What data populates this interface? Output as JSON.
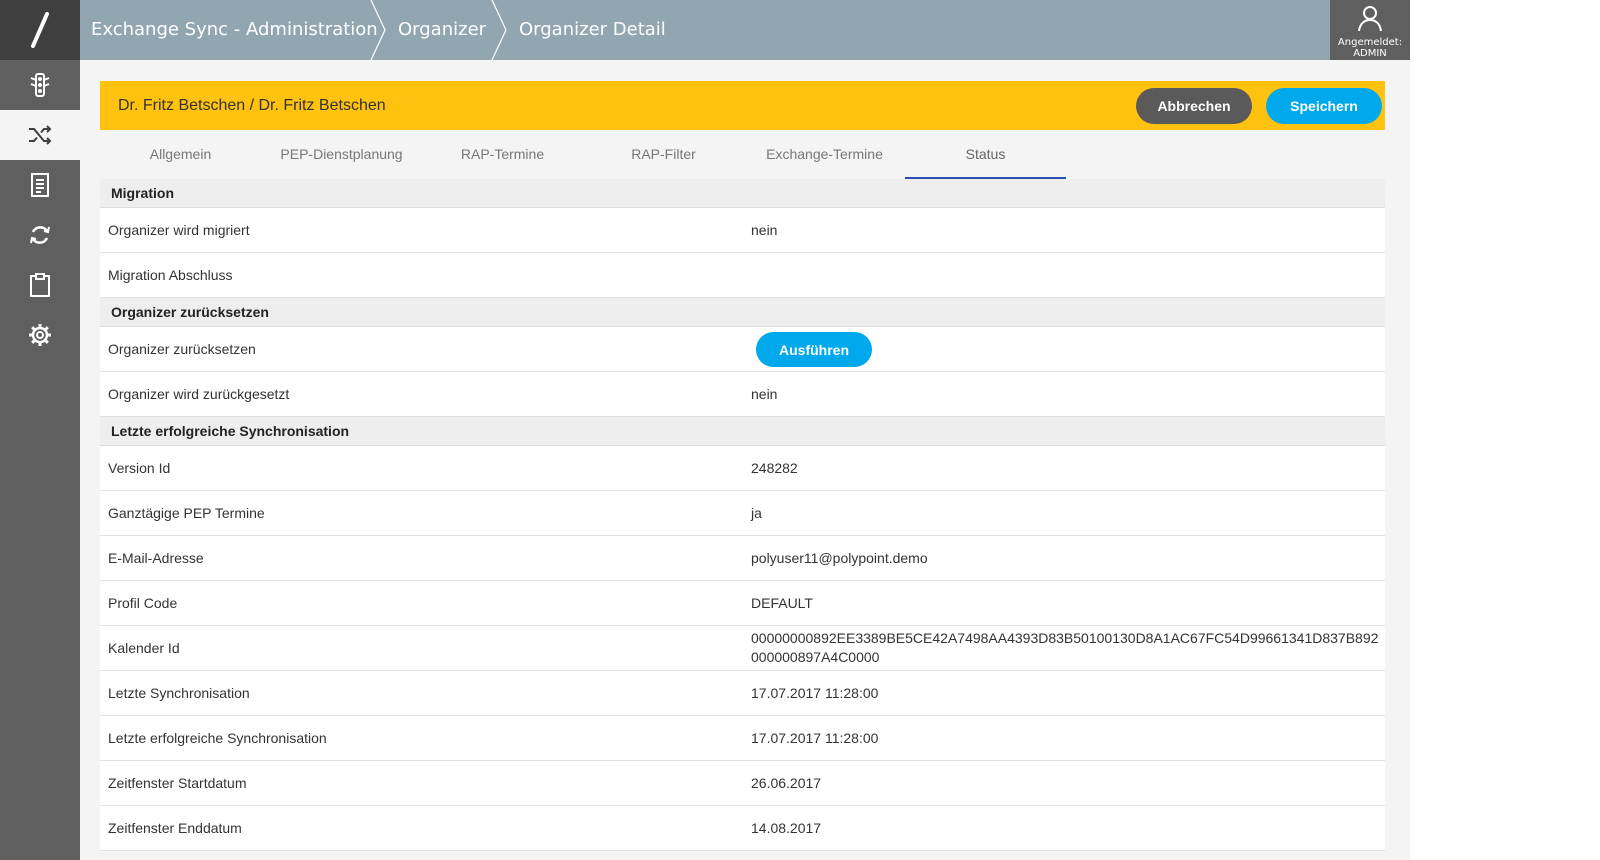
{
  "sidebar": {
    "logo_icon": "slash-logo",
    "items": [
      {
        "icon": "traffic-light-icon",
        "active": false
      },
      {
        "icon": "shuffle-icon",
        "active": true
      },
      {
        "icon": "document-list-icon",
        "active": false
      },
      {
        "icon": "sync-icon",
        "active": false
      },
      {
        "icon": "clipboard-icon",
        "active": false
      },
      {
        "icon": "gear-icon",
        "active": false
      }
    ]
  },
  "header": {
    "breadcrumbs": [
      "Exchange Sync - Administration",
      "Organizer",
      "Organizer Detail"
    ],
    "user_line1": "Angemeldet:",
    "user_line2": "ADMIN"
  },
  "record": {
    "title": "Dr. Fritz Betschen / Dr. Fritz Betschen",
    "cancel_label": "Abbrechen",
    "save_label": "Speichern"
  },
  "tabs": [
    {
      "label": "Allgemein"
    },
    {
      "label": "PEP-Dienstplanung"
    },
    {
      "label": "RAP-Termine"
    },
    {
      "label": "RAP-Filter"
    },
    {
      "label": "Exchange-Termine"
    },
    {
      "label": "Status",
      "active": true
    }
  ],
  "sections": {
    "migration": {
      "title": "Migration",
      "rows": [
        {
          "label": "Organizer wird migriert",
          "value": "nein"
        },
        {
          "label": "Migration Abschluss",
          "value": ""
        }
      ]
    },
    "reset": {
      "title": "Organizer zurücksetzen",
      "action_label": "Organizer zurücksetzen",
      "action_button": "Ausführen",
      "rows": [
        {
          "label": "Organizer wird zurückgesetzt",
          "value": "nein"
        }
      ]
    },
    "sync": {
      "title": "Letzte erfolgreiche Synchronisation",
      "rows": [
        {
          "label": "Version Id",
          "value": "248282"
        },
        {
          "label": "Ganztägige PEP Termine",
          "value": "ja"
        },
        {
          "label": "E-Mail-Adresse",
          "value": "polyuser11@polypoint.demo"
        },
        {
          "label": "Profil Code",
          "value": "DEFAULT"
        },
        {
          "label": "Kalender Id",
          "value": "00000000892EE3389BE5CE42A7498AA4393D83B50100130D8A1AC67FC54D99661341D837B892000000897A4C0000"
        },
        {
          "label": "Letzte Synchronisation",
          "value": "17.07.2017 11:28:00"
        },
        {
          "label": "Letzte erfolgreiche Synchronisation",
          "value": "17.07.2017 11:28:00"
        },
        {
          "label": "Zeitfenster Startdatum",
          "value": "26.06.2017"
        },
        {
          "label": "Zeitfenster Enddatum",
          "value": "14.08.2017"
        }
      ]
    }
  }
}
